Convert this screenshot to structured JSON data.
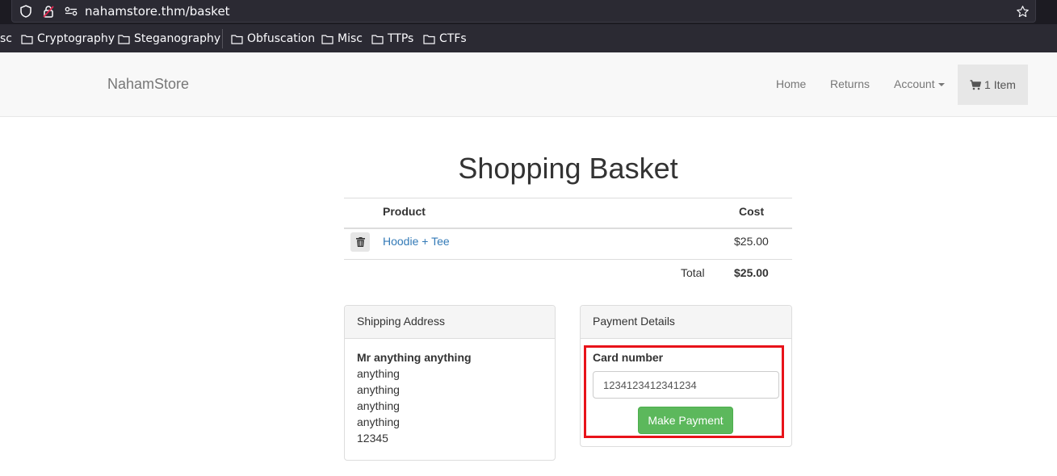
{
  "browser": {
    "url": "nahamstore.thm/basket",
    "bookmarks": [
      "sc",
      "Cryptography",
      "Steganography",
      "Obfuscation",
      "Misc",
      "TTPs",
      "CTFs"
    ]
  },
  "navbar": {
    "brand": "NahamStore",
    "links": [
      "Home",
      "Returns",
      "Account"
    ],
    "cart_label": "1 Item"
  },
  "page": {
    "title": "Shopping Basket"
  },
  "basket": {
    "columns": [
      "Product",
      "Cost"
    ],
    "rows": [
      {
        "product": "Hoodie + Tee",
        "cost": "$25.00"
      }
    ],
    "total_label": "Total",
    "total_value": "$25.00"
  },
  "shipping": {
    "heading": "Shipping Address",
    "name": "Mr anything anything",
    "lines": [
      "anything",
      "anything",
      "anything",
      "anything",
      "12345"
    ]
  },
  "payment": {
    "heading": "Payment Details",
    "card_label": "Card number",
    "card_value": "1234123412341234",
    "button_label": "Make Payment"
  },
  "colors": {
    "link": "#337ab7",
    "success": "#5cb85c",
    "highlight": "#e8131a"
  }
}
